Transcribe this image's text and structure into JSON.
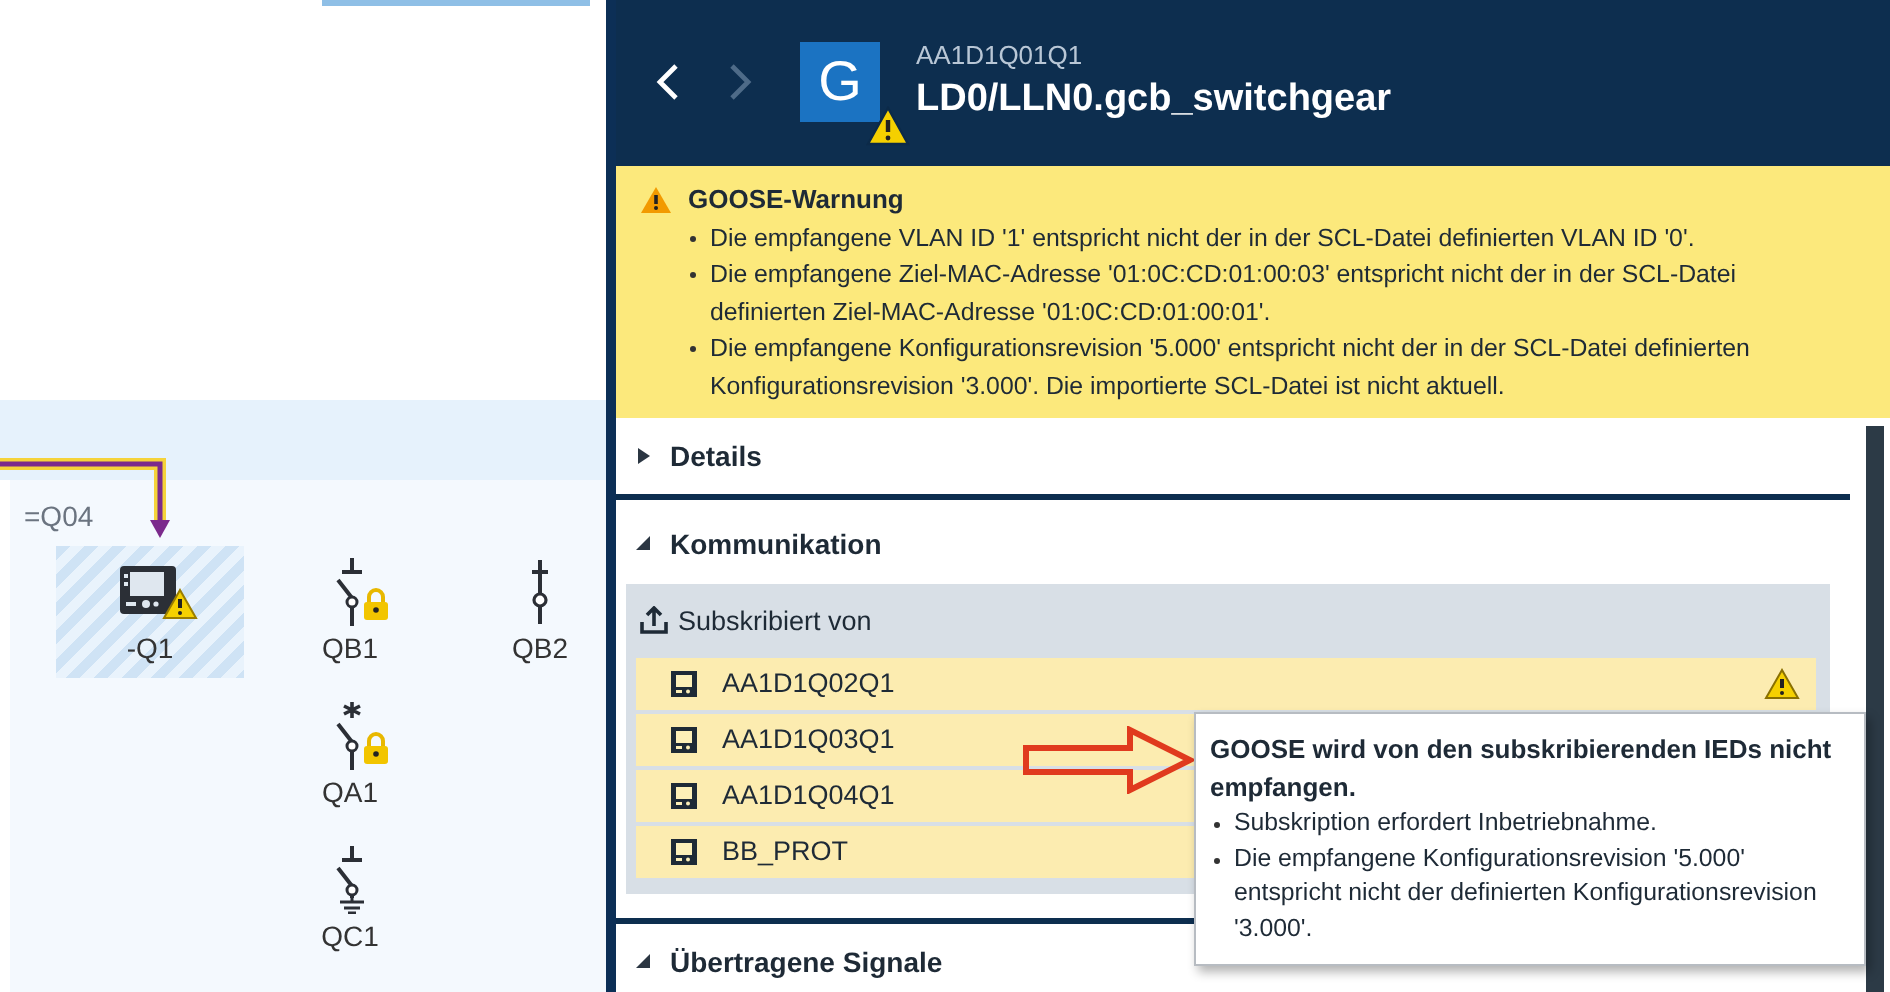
{
  "canvas": {
    "bay_label": "=Q04",
    "columns": [
      [
        {
          "label": "-Q1",
          "kind": "ied",
          "locked": false,
          "warning": true,
          "selected": true
        }
      ],
      [
        {
          "label": "QB1",
          "kind": "disconnector",
          "locked": true,
          "warning": false,
          "selected": false
        },
        {
          "label": "QA1",
          "kind": "breaker",
          "locked": true,
          "warning": false,
          "selected": false
        },
        {
          "label": "QC1",
          "kind": "earthing",
          "locked": false,
          "warning": false,
          "selected": false
        }
      ],
      [
        {
          "label": "QB2",
          "kind": "isolator",
          "locked": false,
          "warning": false,
          "selected": false
        }
      ]
    ]
  },
  "header": {
    "back_enabled": true,
    "forward_enabled": false,
    "tile_letter": "G",
    "tile_warning": true,
    "subtitle": "AA1D1Q01Q1",
    "title": "LD0/LLN0.gcb_switchgear"
  },
  "warning": {
    "title": "GOOSE-Warnung",
    "items": [
      "Die empfangene VLAN ID '1' entspricht nicht der in der SCL-Datei definierten VLAN ID '0'.",
      "Die empfangene Ziel-MAC-Adresse '01:0C:CD:01:00:03' entspricht nicht der in der SCL-Datei definierten Ziel-MAC-Adresse '01:0C:CD:01:00:01'.",
      "Die empfangene Konfigurationsrevision '5.000' entspricht nicht der in der SCL-Datei definierten Konfigurationsrevision '3.000'. Die importierte SCL-Datei ist nicht aktuell."
    ]
  },
  "sections": [
    {
      "title": "Details",
      "expanded": false
    },
    {
      "title": "Kommunikation",
      "expanded": true,
      "group": {
        "title": "Subskribiert von",
        "rows": [
          {
            "name": "AA1D1Q02Q1",
            "warning": true
          },
          {
            "name": "AA1D1Q03Q1"
          },
          {
            "name": "AA1D1Q04Q1"
          },
          {
            "name": "BB_PROT"
          }
        ]
      }
    },
    {
      "title": "Übertragene Signale",
      "expanded": true
    }
  ],
  "tooltip": {
    "title": "GOOSE wird von den subskribierenden IEDs nicht empfangen.",
    "items": [
      "Subskription erfordert Inbetriebnahme.",
      "Die empfangene Konfigurationsrevision '5.000' entspricht nicht der definierten Konfigurationsrevision '3.000'."
    ]
  }
}
